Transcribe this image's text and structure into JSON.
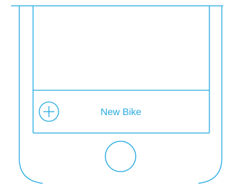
{
  "new_bike": {
    "label": "New Bike",
    "icon": "plus-circle-icon"
  },
  "home_button": {
    "icon": "home-button"
  },
  "colors": {
    "accent": "#27aae1",
    "outline": "#27aae1",
    "background": "#ffffff"
  }
}
